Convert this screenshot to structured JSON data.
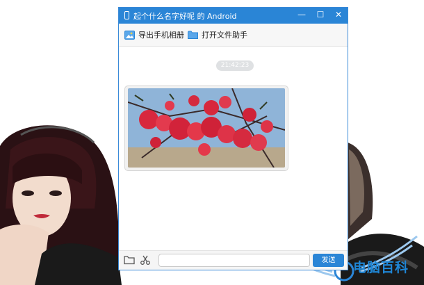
{
  "window": {
    "title": "起个什么名字好呢 的 Android",
    "minimize_glyph": "—",
    "maximize_glyph": "☐",
    "close_glyph": "✕"
  },
  "toolbar": {
    "items": [
      {
        "label": "导出手机相册",
        "icon": "export-photo-icon"
      },
      {
        "label": "打开文件助手",
        "icon": "folder-icon"
      }
    ]
  },
  "chat": {
    "timestamp": "21:42:23",
    "messages": [
      {
        "type": "image",
        "description": "photo"
      }
    ]
  },
  "input": {
    "value": "",
    "placeholder": "",
    "send_label": "发送",
    "icons": [
      "folder-icon",
      "scissors-icon"
    ]
  },
  "watermark": {
    "text": "电脑百科"
  },
  "colors": {
    "accent": "#2a85d6",
    "window_bg": "#ffffff",
    "toolbar_bg": "#f7f7f7",
    "timestamp_bg": "#dfe1e3"
  }
}
